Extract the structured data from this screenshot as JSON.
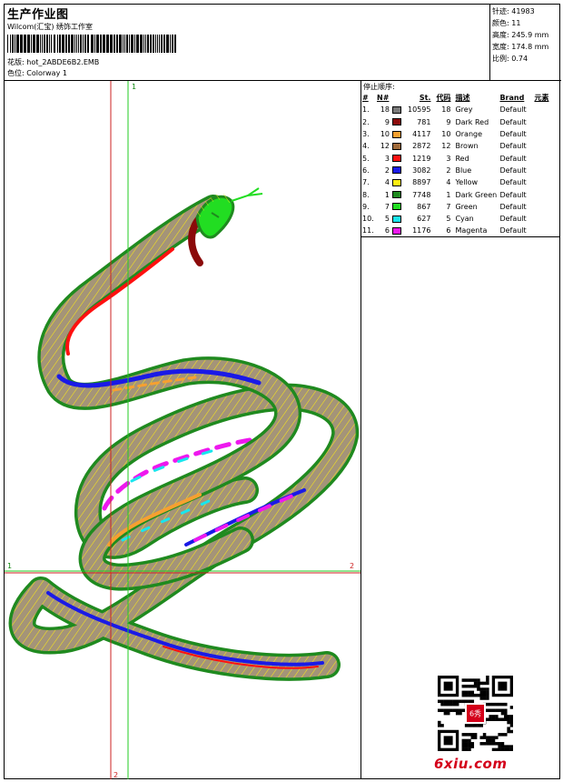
{
  "header": {
    "title": "生产作业图",
    "software": "Wilcom(汇宝) 绣饰工作室",
    "design_label": "花版:",
    "design_file": "hot_2ABDE6B2.EMB",
    "colorway_label": "色位:",
    "colorway": "Colorway 1"
  },
  "stats": {
    "stitches_label": "针迹:",
    "stitches": "41983",
    "colors_label": "颜色:",
    "colors": "11",
    "height_label": "高度:",
    "height": "245.9 mm",
    "width_label": "宽度:",
    "width": "174.8 mm",
    "scale_label": "比例:",
    "scale": "0.74"
  },
  "stop_sequence": {
    "title": "停止顺序:",
    "columns": [
      "#",
      "N#",
      "St.",
      "代码",
      "描述",
      "Brand",
      "元素"
    ],
    "rows": [
      {
        "idx": "1.",
        "n": "18",
        "color": "#7a7a7a",
        "st": "10595",
        "code": "18",
        "desc": "Grey",
        "brand": "Default"
      },
      {
        "idx": "2.",
        "n": "9",
        "color": "#8b0a0a",
        "st": "781",
        "code": "9",
        "desc": "Dark Red",
        "brand": "Default"
      },
      {
        "idx": "3.",
        "n": "10",
        "color": "#f7a030",
        "st": "4117",
        "code": "10",
        "desc": "Orange",
        "brand": "Default"
      },
      {
        "idx": "4.",
        "n": "12",
        "color": "#a06a3a",
        "st": "2872",
        "code": "12",
        "desc": "Brown",
        "brand": "Default"
      },
      {
        "idx": "5.",
        "n": "3",
        "color": "#ff1010",
        "st": "1219",
        "code": "3",
        "desc": "Red",
        "brand": "Default"
      },
      {
        "idx": "6.",
        "n": "2",
        "color": "#1a1ae6",
        "st": "3082",
        "code": "2",
        "desc": "Blue",
        "brand": "Default"
      },
      {
        "idx": "7.",
        "n": "4",
        "color": "#ffee10",
        "st": "8897",
        "code": "4",
        "desc": "Yellow",
        "brand": "Default"
      },
      {
        "idx": "8.",
        "n": "1",
        "color": "#1f8a1f",
        "st": "7748",
        "code": "1",
        "desc": "Dark Green",
        "brand": "Default"
      },
      {
        "idx": "9.",
        "n": "7",
        "color": "#22dd22",
        "st": "867",
        "code": "7",
        "desc": "Green",
        "brand": "Default"
      },
      {
        "idx": "10.",
        "n": "5",
        "color": "#18e6ee",
        "st": "627",
        "code": "5",
        "desc": "Cyan",
        "brand": "Default"
      },
      {
        "idx": "11.",
        "n": "6",
        "color": "#ee18ee",
        "st": "1176",
        "code": "6",
        "desc": "Magenta",
        "brand": "Default"
      }
    ]
  },
  "guides": {
    "top_label": "1",
    "left_label": "1",
    "right_label": "2",
    "bottom_label": "2"
  },
  "watermark": {
    "site": "6xiu.com",
    "seal_text": "6秀"
  }
}
